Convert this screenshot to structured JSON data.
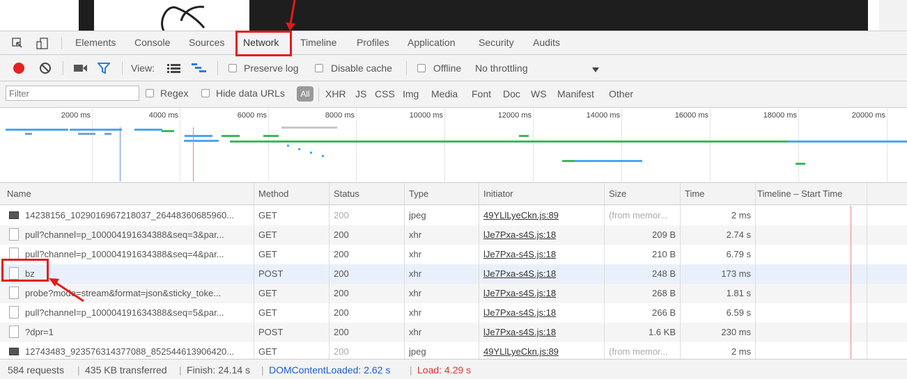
{
  "tabs": [
    "Elements",
    "Console",
    "Sources",
    "Network",
    "Timeline",
    "Profiles",
    "Application",
    "Security",
    "Audits"
  ],
  "toolbar": {
    "view_label": "View:",
    "preserve_log": "Preserve log",
    "disable_cache": "Disable cache",
    "offline": "Offline",
    "throttling": "No throttling"
  },
  "filter": {
    "placeholder": "Filter",
    "regex": "Regex",
    "hide_data_urls": "Hide data URLs",
    "all": "All",
    "types": [
      "XHR",
      "JS",
      "CSS",
      "Img",
      "Media",
      "Font",
      "Doc",
      "WS",
      "Manifest",
      "Other"
    ]
  },
  "overview": {
    "ticks": [
      "2000 ms",
      "4000 ms",
      "6000 ms",
      "8000 ms",
      "10000 ms",
      "12000 ms",
      "14000 ms",
      "16000 ms",
      "18000 ms",
      "20000 ms"
    ]
  },
  "table": {
    "headers": [
      "Name",
      "Method",
      "Status",
      "Type",
      "Initiator",
      "Size",
      "Time",
      "Timeline – Start Time"
    ],
    "rows": [
      {
        "icon": "image",
        "name": "14238156_1029016967218037_26448360685960...",
        "method": "GET",
        "status": "200",
        "type": "jpeg",
        "initiator": "49YLlLyeCkn.js:89",
        "size": "(from memor...",
        "time": "2 ms"
      },
      {
        "icon": "file",
        "name": "pull?channel=p_100004191634388&seq=3&par...",
        "method": "GET",
        "status": "200",
        "type": "xhr",
        "initiator": "lJe7Pxa-s4S.js:18",
        "size": "209 B",
        "time": "2.74 s"
      },
      {
        "icon": "file",
        "name": "pull?channel=p_100004191634388&seq=4&par...",
        "method": "GET",
        "status": "200",
        "type": "xhr",
        "initiator": "lJe7Pxa-s4S.js:18",
        "size": "210 B",
        "time": "6.79 s"
      },
      {
        "icon": "file",
        "name": "bz",
        "method": "POST",
        "status": "200",
        "type": "xhr",
        "initiator": "lJe7Pxa-s4S.js:18",
        "size": "248 B",
        "time": "173 ms"
      },
      {
        "icon": "file",
        "name": "probe?mode=stream&format=json&sticky_toke...",
        "method": "GET",
        "status": "200",
        "type": "xhr",
        "initiator": "lJe7Pxa-s4S.js:18",
        "size": "268 B",
        "time": "1.81 s"
      },
      {
        "icon": "file",
        "name": "pull?channel=p_100004191634388&seq=5&par...",
        "method": "GET",
        "status": "200",
        "type": "xhr",
        "initiator": "lJe7Pxa-s4S.js:18",
        "size": "266 B",
        "time": "6.59 s"
      },
      {
        "icon": "file",
        "name": "?dpr=1",
        "method": "POST",
        "status": "200",
        "type": "xhr",
        "initiator": "lJe7Pxa-s4S.js:18",
        "size": "1.6 KB",
        "time": "230 ms"
      },
      {
        "icon": "image",
        "name": "12743483_923576314377088_852544613906420...",
        "method": "GET",
        "status": "200",
        "type": "jpeg",
        "initiator": "49YLlLyeCkn.js:89",
        "size": "(from memor...",
        "time": "2 ms"
      }
    ]
  },
  "status": {
    "requests": "584 requests",
    "transferred": "435 KB transferred",
    "finish": "Finish: 24.14 s",
    "dcl": "DOMContentLoaded: 2.62 s",
    "load": "Load: 4.29 s",
    "dcl_color": "#1a5fd1",
    "load_color": "#d33"
  },
  "colors": {
    "annotation": "#e51a1a",
    "bar_blue": "#49a7f2",
    "bar_green": "#3cb85a",
    "record": "#e52222",
    "filter_icon": "#2b7de0"
  }
}
